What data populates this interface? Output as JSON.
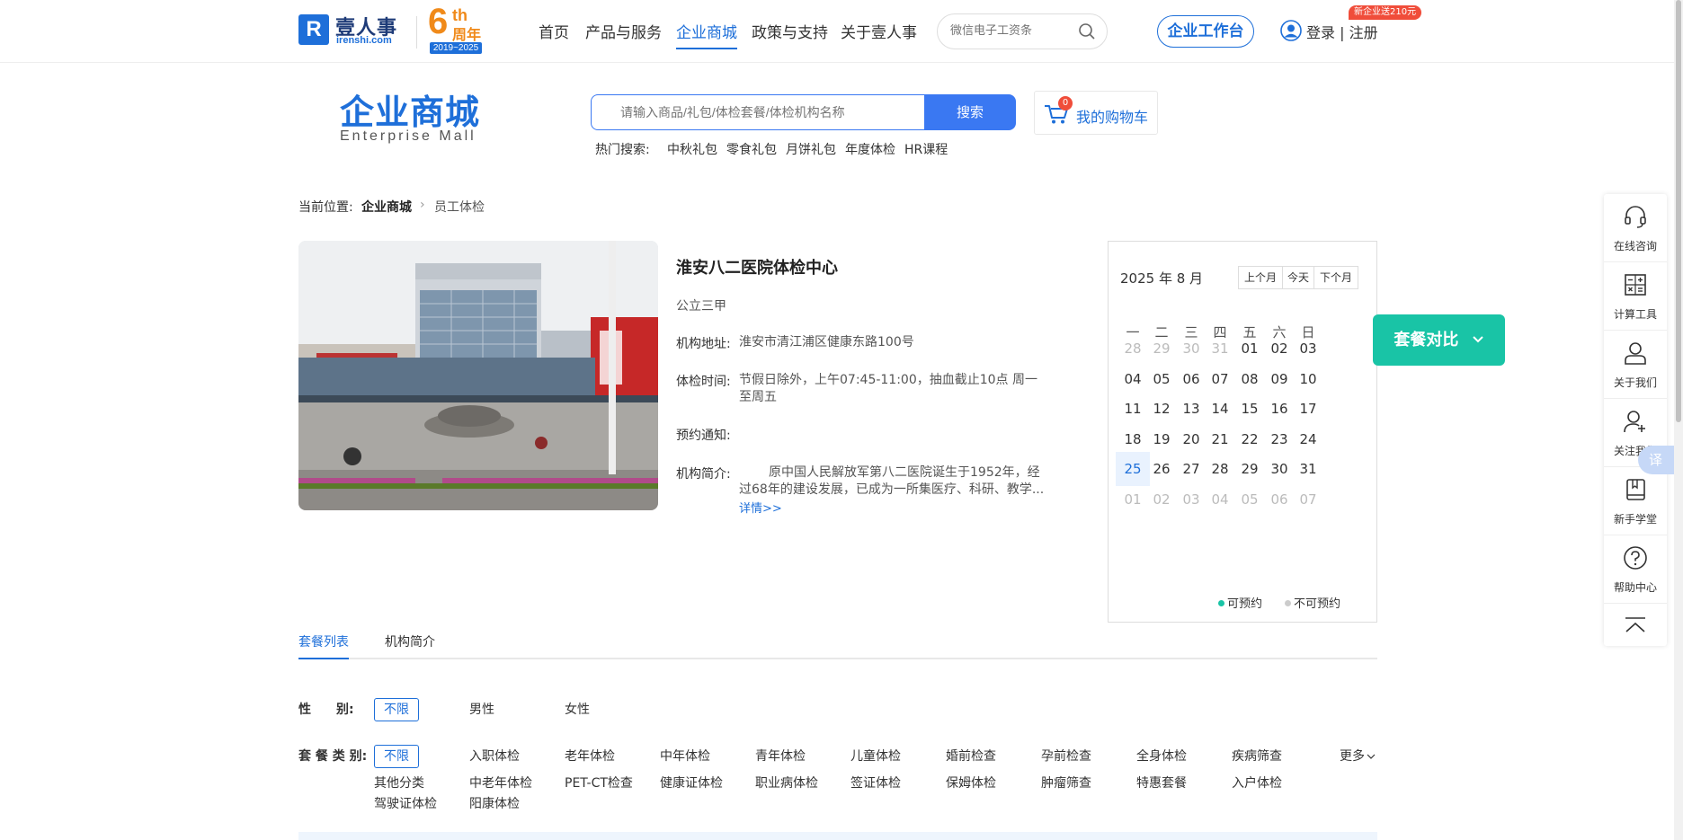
{
  "header": {
    "logo": {
      "mark": "R",
      "name": "壹人事",
      "domain": "irenshi.com"
    },
    "anniversary": {
      "number": "6",
      "suffix": "th",
      "zh": "周年",
      "years": "2019~2025"
    },
    "nav": [
      "首页",
      "产品与服务",
      "企业商城",
      "政策与支持",
      "关于壹人事"
    ],
    "active_nav": "企业商城",
    "search_placeholder": "微信电子工资条",
    "workspace_button": "企业工作台",
    "login": "登录 | 注册",
    "promo_badge": "新企业送210元"
  },
  "mall": {
    "title": "企业商城",
    "subtitle": "Enterprise  Mall",
    "search_placeholder": "请输入商品/礼包/体检套餐/体检机构名称",
    "search_button": "搜索",
    "cart_label": "我的购物车",
    "cart_count": "0",
    "hot_label": "热门搜索:",
    "hot_items": [
      "中秋礼包",
      "零食礼包",
      "月饼礼包",
      "年度体检",
      "HR课程"
    ]
  },
  "breadcrumb": {
    "prefix": "当前位置:",
    "items": [
      "企业商城",
      "员工体检"
    ],
    "separator": "›"
  },
  "organization": {
    "name": "淮安八二医院体检中心",
    "grade": "公立三甲",
    "fields": {
      "address_label": "机构地址:",
      "address": "淮安市清江浦区健康东路100号",
      "hours_label": "体检时间:",
      "hours_line1": "节假日除外，上午07:45-11:00，抽血截止10点 周一",
      "hours_line2": "至周五",
      "notice_label": "预约通知:",
      "notice": "",
      "intro_label": "机构简介:",
      "intro_line1": "原中国人民解放军第八二医院诞生于1952年，经",
      "intro_line2": "过68年的建设发展，已成为一所集医疗、科研、教学..."
    },
    "more_link": "详情>>"
  },
  "calendar": {
    "title": "2025 年 8 月",
    "buttons": [
      "上个月",
      "今天",
      "下个月"
    ],
    "weekdays": [
      "一",
      "二",
      "三",
      "四",
      "五",
      "六",
      "日"
    ],
    "weeks": [
      [
        "28",
        "29",
        "30",
        "31",
        "01",
        "02",
        "03"
      ],
      [
        "04",
        "05",
        "06",
        "07",
        "08",
        "09",
        "10"
      ],
      [
        "11",
        "12",
        "13",
        "14",
        "15",
        "16",
        "17"
      ],
      [
        "18",
        "19",
        "20",
        "21",
        "22",
        "23",
        "24"
      ],
      [
        "25",
        "26",
        "27",
        "28",
        "29",
        "30",
        "31"
      ],
      [
        "01",
        "02",
        "03",
        "04",
        "05",
        "06",
        "07"
      ]
    ],
    "today": "25",
    "legend": {
      "available": "可预约",
      "unavailable": "不可预约"
    },
    "colors": {
      "available": "#19c4a6",
      "unavailable": "#cccccc"
    }
  },
  "compare_button": "套餐对比",
  "tabs": [
    "套餐列表",
    "机构简介"
  ],
  "filters": {
    "gender_label": "性　　别:",
    "gender_options": [
      "不限",
      "男性",
      "女性"
    ],
    "category_label": "套 餐 类 别:",
    "category_options": [
      "不限",
      "入职体检",
      "老年体检",
      "中年体检",
      "青年体检",
      "儿童体检",
      "婚前检查",
      "孕前检查",
      "全身体检",
      "疾病筛查",
      "其他分类",
      "中老年体检",
      "PET-CT检查",
      "健康证体检",
      "职业病体检",
      "签证体检",
      "保姆体检",
      "肿瘤筛查",
      "特惠套餐",
      "入户体检",
      "驾驶证体检",
      "阳康体检"
    ],
    "more": "更多"
  },
  "sidebar": [
    "在线咨询",
    "计算工具",
    "关于我们",
    "关注我们",
    "新手学堂",
    "帮助中心"
  ],
  "translate": "译",
  "colors": {
    "brand_blue": "#1e6fd9",
    "search_blue": "#3a78f2",
    "teal": "#19c4a6",
    "anniversary_orange": "#f08a1a",
    "promo_red": "#f04d3a"
  }
}
